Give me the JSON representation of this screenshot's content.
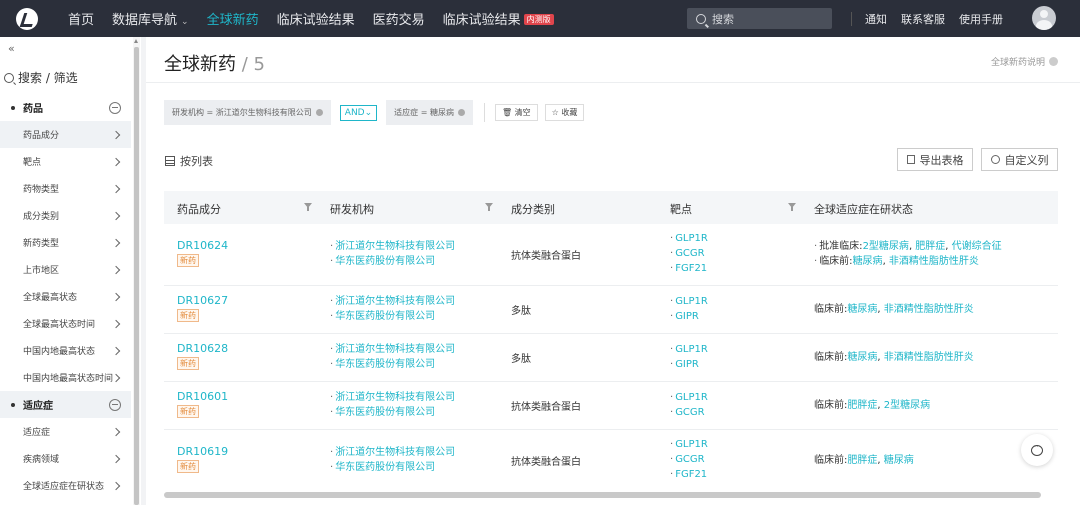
{
  "topnav": {
    "items": [
      "首页",
      "数据库导航",
      "全球新药",
      "临床试验结果",
      "医药交易",
      "临床试验结果"
    ],
    "new_badge": "内测版",
    "search_placeholder": "搜索",
    "links": [
      "通知",
      "联系客服",
      "使用手册"
    ],
    "active_color": "#1fb6c9"
  },
  "sidebar": {
    "collapse_label": "«",
    "search_label": "搜索 / 筛选",
    "groups": [
      {
        "label": "药品",
        "items": [
          "药品成分",
          "靶点",
          "药物类型",
          "成分类别",
          "新药类型",
          "上市地区",
          "全球最高状态",
          "全球最高状态时间",
          "中国内地最高状态",
          "中国内地最高状态时间"
        ]
      },
      {
        "label": "适应症",
        "items": [
          "适应症",
          "疾病领域",
          "全球适应症在研状态"
        ]
      }
    ]
  },
  "main": {
    "title": "全球新药",
    "count_sep": " / ",
    "count": "5",
    "help_label": "全球新药说明",
    "filters": {
      "chip1": "研发机构 = 浙江道尔生物科技有限公司",
      "and_label": "AND",
      "chip2": "适应症 = 糖尿病",
      "clear_label": "清空",
      "fav_label": "收藏"
    },
    "list_label": "按列表",
    "export_label": "导出表格",
    "custom_label": "自定义列",
    "columns": [
      "药品成分",
      "研发机构",
      "成分类别",
      "靶点",
      "全球适应症在研状态"
    ],
    "new_tag": "新药",
    "rows": [
      {
        "id": "DR10624",
        "orgs": [
          "浙江道尔生物科技有限公司",
          "华东医药股份有限公司"
        ],
        "type": "抗体类融合蛋白",
        "targets": [
          "GLP1R",
          "GCGR",
          "FGF21"
        ],
        "status": [
          {
            "phase": "批准临床:",
            "items": [
              "2型糖尿病",
              "肥胖症",
              "代谢综合征"
            ]
          },
          {
            "phase": "临床前:",
            "items": [
              "糖尿病",
              "非酒精性脂肪性肝炎"
            ]
          }
        ]
      },
      {
        "id": "DR10627",
        "orgs": [
          "浙江道尔生物科技有限公司",
          "华东医药股份有限公司"
        ],
        "type": "多肽",
        "targets": [
          "GLP1R",
          "GIPR"
        ],
        "status": [
          {
            "phase": "临床前:",
            "items": [
              "糖尿病",
              "非酒精性脂肪性肝炎"
            ]
          }
        ]
      },
      {
        "id": "DR10628",
        "orgs": [
          "浙江道尔生物科技有限公司",
          "华东医药股份有限公司"
        ],
        "type": "多肽",
        "targets": [
          "GLP1R",
          "GIPR"
        ],
        "status": [
          {
            "phase": "临床前:",
            "items": [
              "糖尿病",
              "非酒精性脂肪性肝炎"
            ]
          }
        ]
      },
      {
        "id": "DR10601",
        "orgs": [
          "浙江道尔生物科技有限公司",
          "华东医药股份有限公司"
        ],
        "type": "抗体类融合蛋白",
        "targets": [
          "GLP1R",
          "GCGR"
        ],
        "status": [
          {
            "phase": "临床前:",
            "items": [
              "肥胖症",
              "2型糖尿病"
            ]
          }
        ]
      },
      {
        "id": "DR10619",
        "orgs": [
          "浙江道尔生物科技有限公司",
          "华东医药股份有限公司"
        ],
        "type": "抗体类融合蛋白",
        "targets": [
          "GLP1R",
          "GCGR",
          "FGF21"
        ],
        "status": [
          {
            "phase": "临床前:",
            "items": [
              "肥胖症",
              "糖尿病"
            ]
          }
        ]
      }
    ]
  }
}
